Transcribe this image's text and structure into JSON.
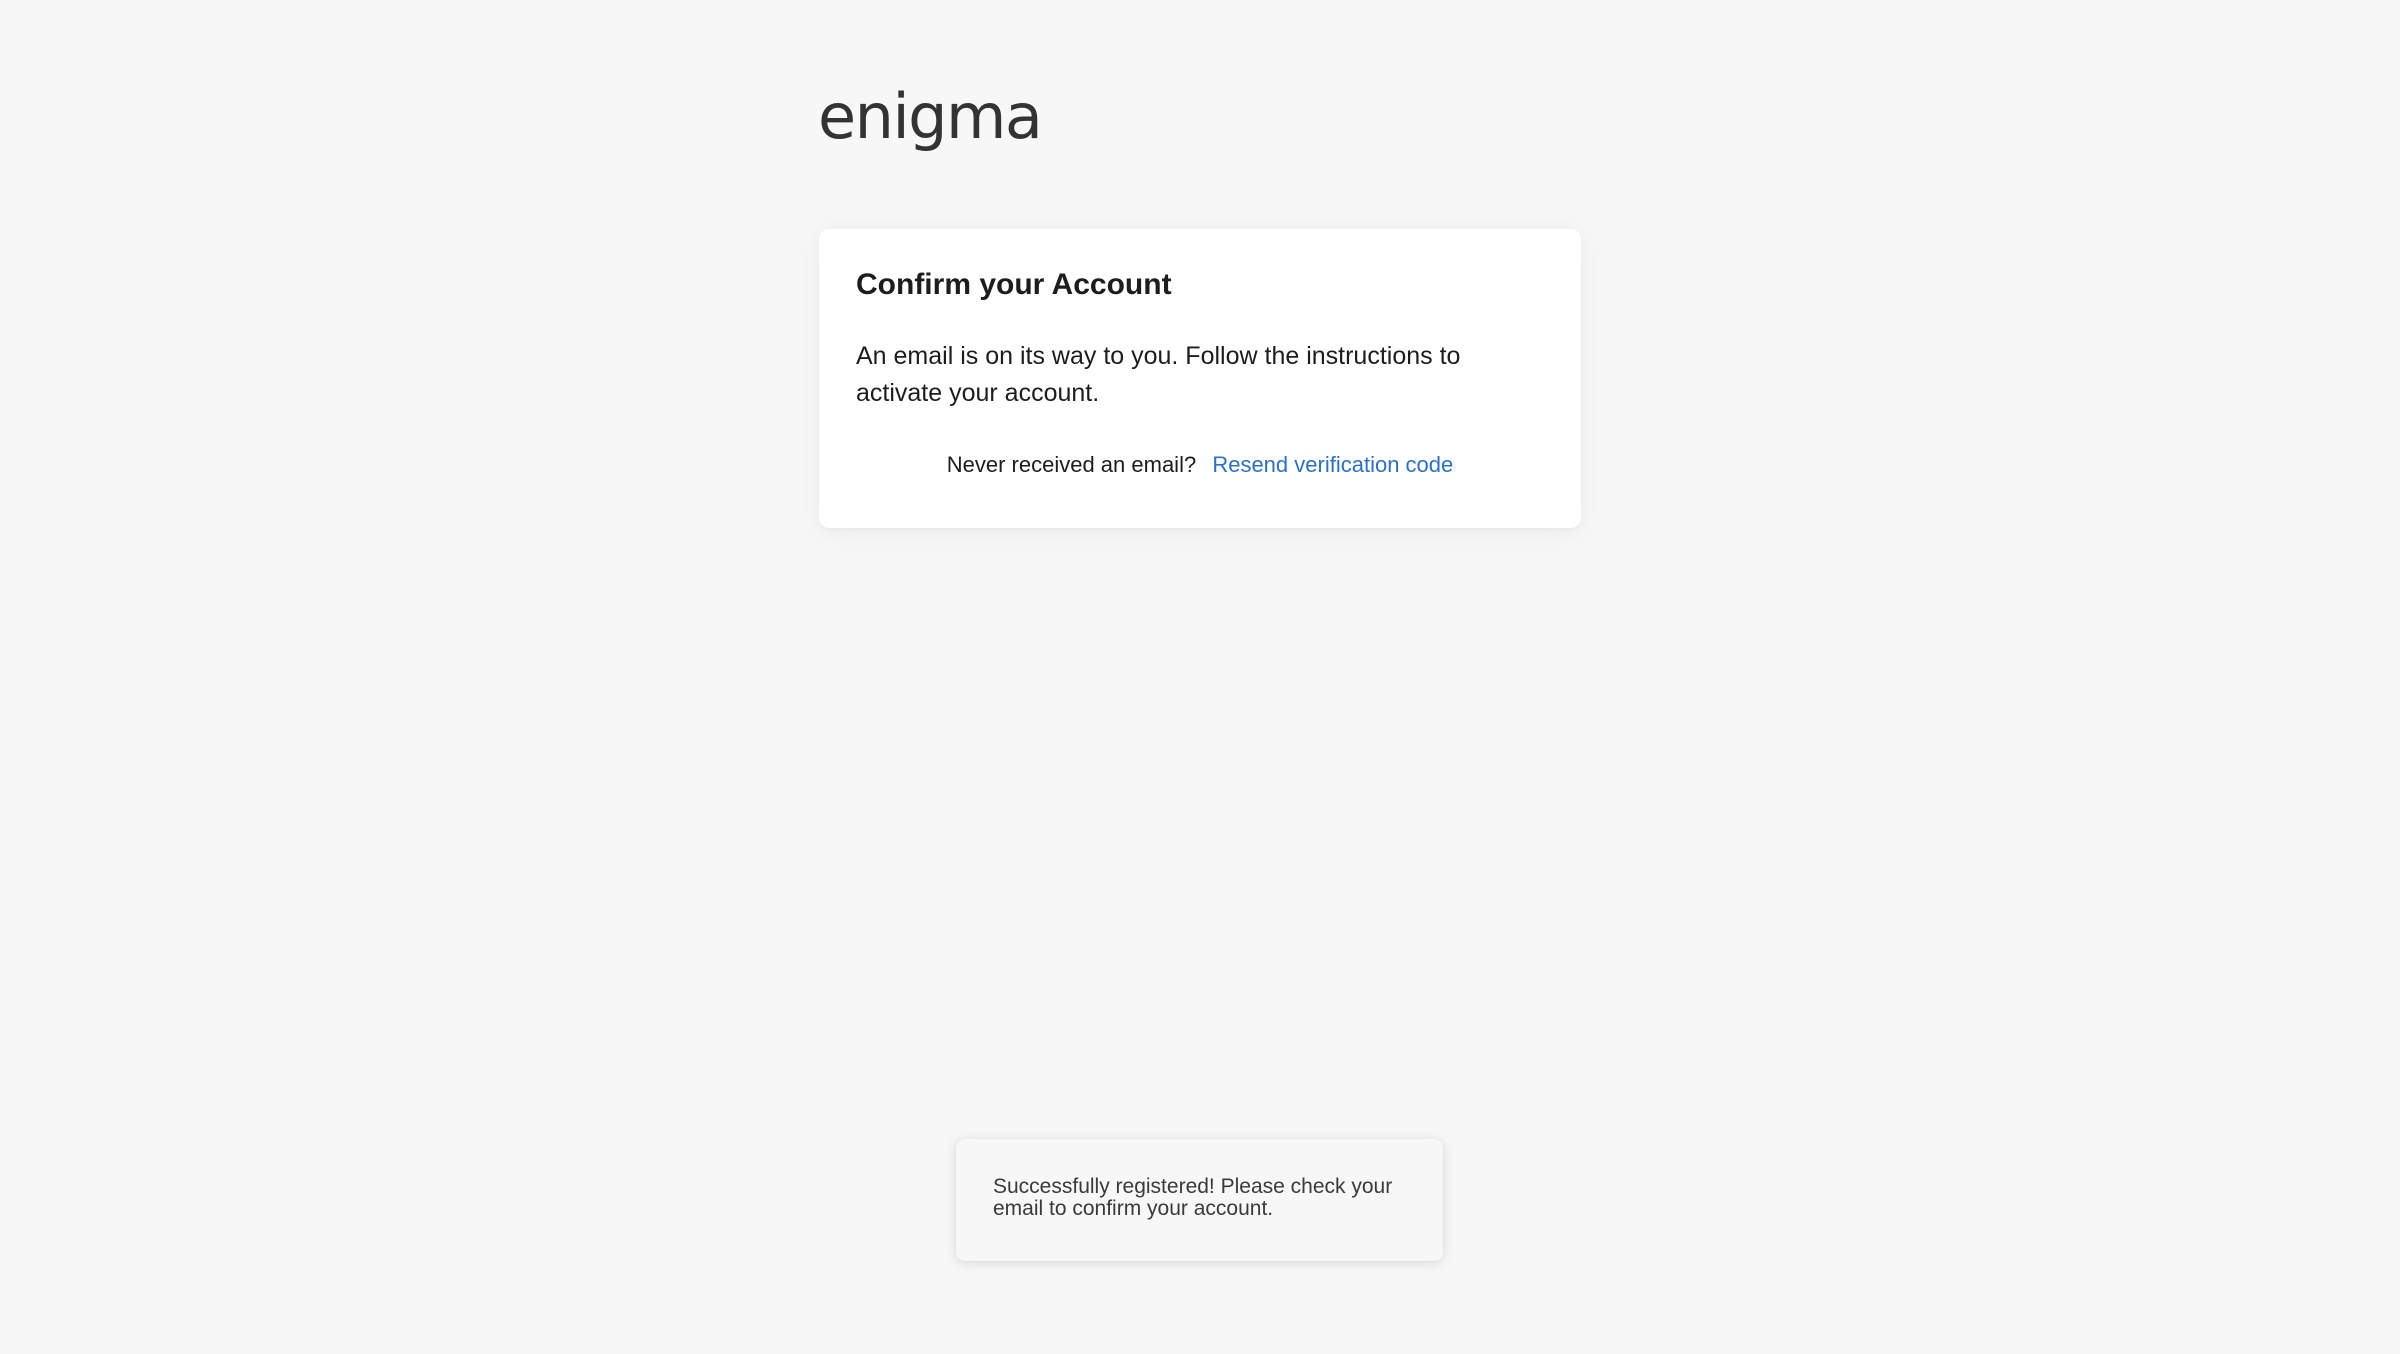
{
  "brand": {
    "logo_text": "enigma"
  },
  "card": {
    "title": "Confirm your Account",
    "message": "An email is on its way to you. Follow the instructions to activate your account.",
    "resend_prompt": "Never received an email?",
    "resend_link": "Resend verification code"
  },
  "toast": {
    "message": "Successfully registered! Please check your email to confirm your account."
  },
  "colors": {
    "background": "#f7f7f7",
    "card": "#ffffff",
    "link": "#2d6fc4",
    "text": "#1d1d1d",
    "logo": "#333333"
  }
}
